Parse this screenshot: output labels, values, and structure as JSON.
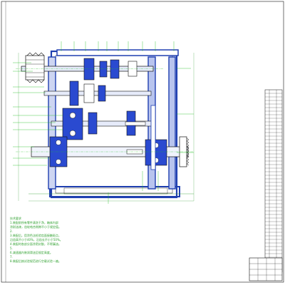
{
  "drawing": {
    "technical_notes": [
      "技术要求",
      "1.装配前所有零件清洗干净，箱体内部",
      "  涂耐油漆，齿轮啮合侧隙不小于规定值。",
      "2.",
      "3.装配后，用涂色法检验齿面接触斑点，",
      "  沿齿高不小于40%，沿齿长不小于50%。",
      "4.装配时各剖分面涂密封胶，不得漏油。",
      "5.",
      "6.减速器内装润滑油至规定高度。",
      "7.",
      "8.装配后按试验规范进行空载试验一遍。"
    ],
    "colors": {
      "outline": "#111111",
      "housing_fill": "#1f3fb0",
      "shaft_fill": "#d0d8f0",
      "gear_fill": "#2a4ad0",
      "leader": "#1fbf1f",
      "dimension": "#2ea02e",
      "hatch": "#8a8ae0"
    }
  }
}
